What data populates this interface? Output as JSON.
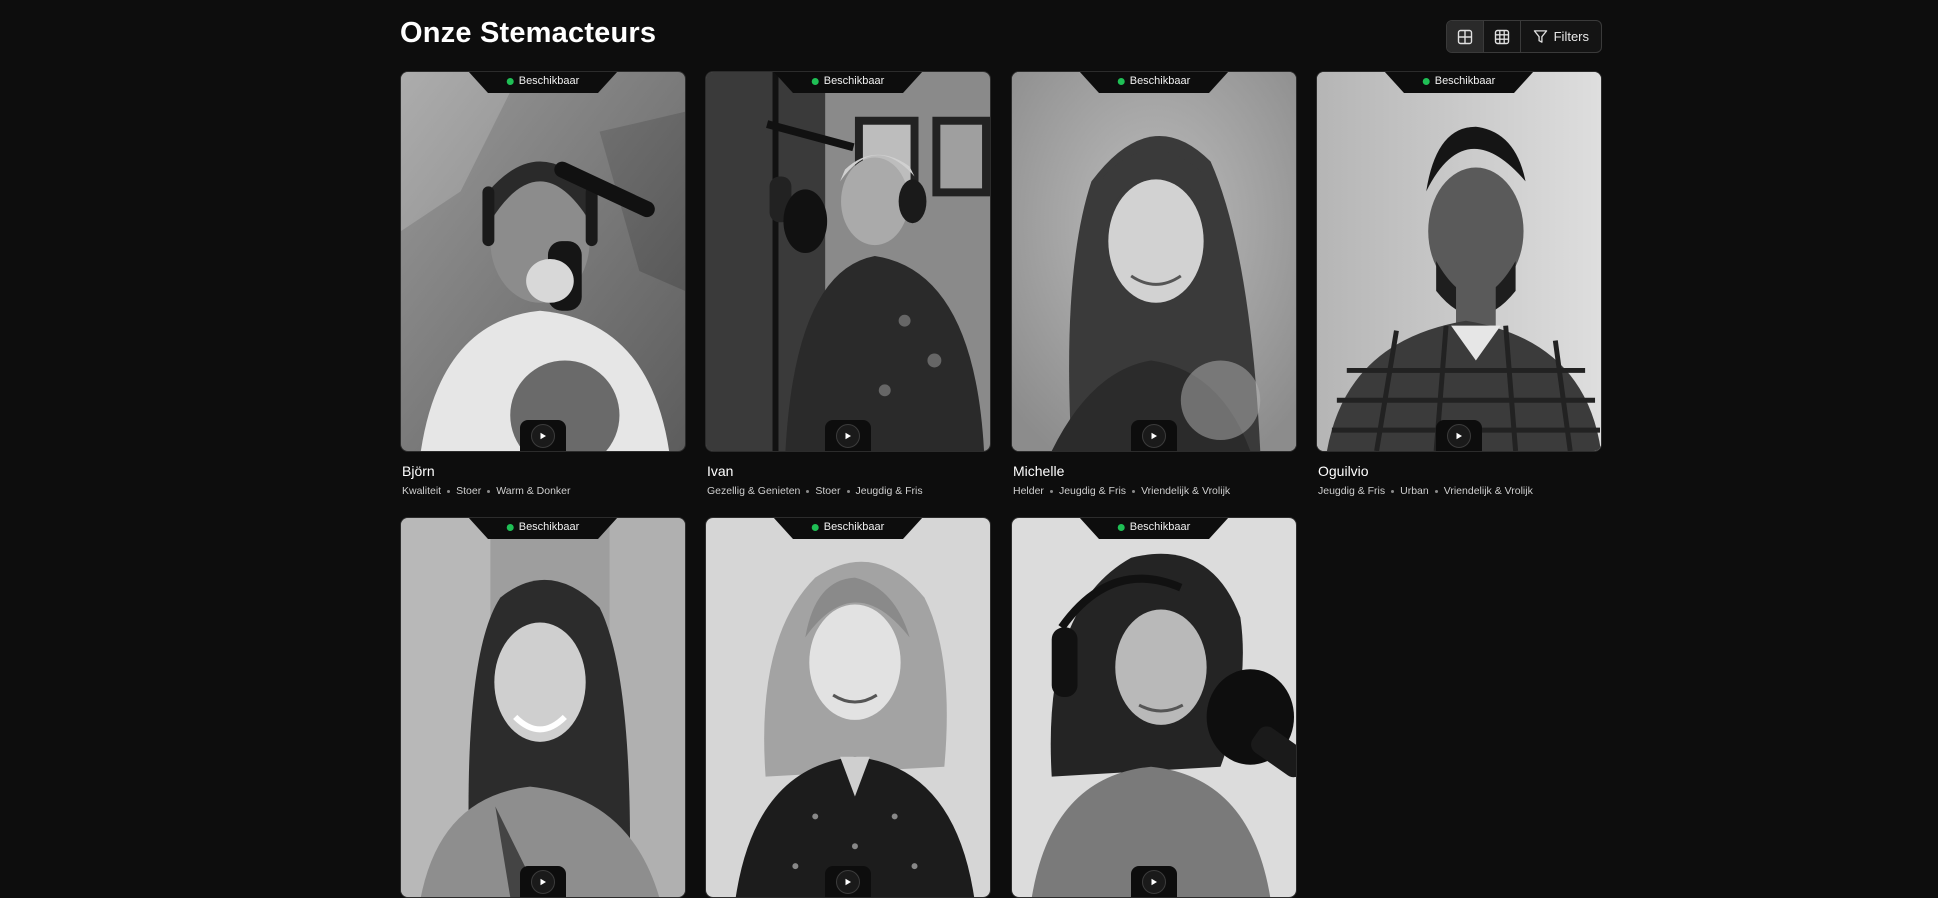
{
  "header": {
    "title": "Onze Stemacteurs",
    "toolbar": {
      "view_large_icon": "grid-2x2-icon",
      "view_small_icon": "grid-3x3-icon",
      "filter_icon": "filter-icon",
      "filter_label": "Filters"
    }
  },
  "colors": {
    "background": "#0d0d0d",
    "status_available": "#1fbf55"
  },
  "status_label": "Beschikbaar",
  "actors": [
    {
      "name": "Björn",
      "tags": [
        "Kwaliteit",
        "Stoer",
        "Warm & Donker"
      ]
    },
    {
      "name": "Ivan",
      "tags": [
        "Gezellig & Genieten",
        "Stoer",
        "Jeugdig & Fris"
      ]
    },
    {
      "name": "Michelle",
      "tags": [
        "Helder",
        "Jeugdig & Fris",
        "Vriendelijk & Vrolijk"
      ]
    },
    {
      "name": "Oguilvio",
      "tags": [
        "Jeugdig & Fris",
        "Urban",
        "Vriendelijk & Vrolijk"
      ]
    },
    {
      "name": "",
      "tags": []
    },
    {
      "name": "",
      "tags": []
    },
    {
      "name": "",
      "tags": []
    }
  ]
}
